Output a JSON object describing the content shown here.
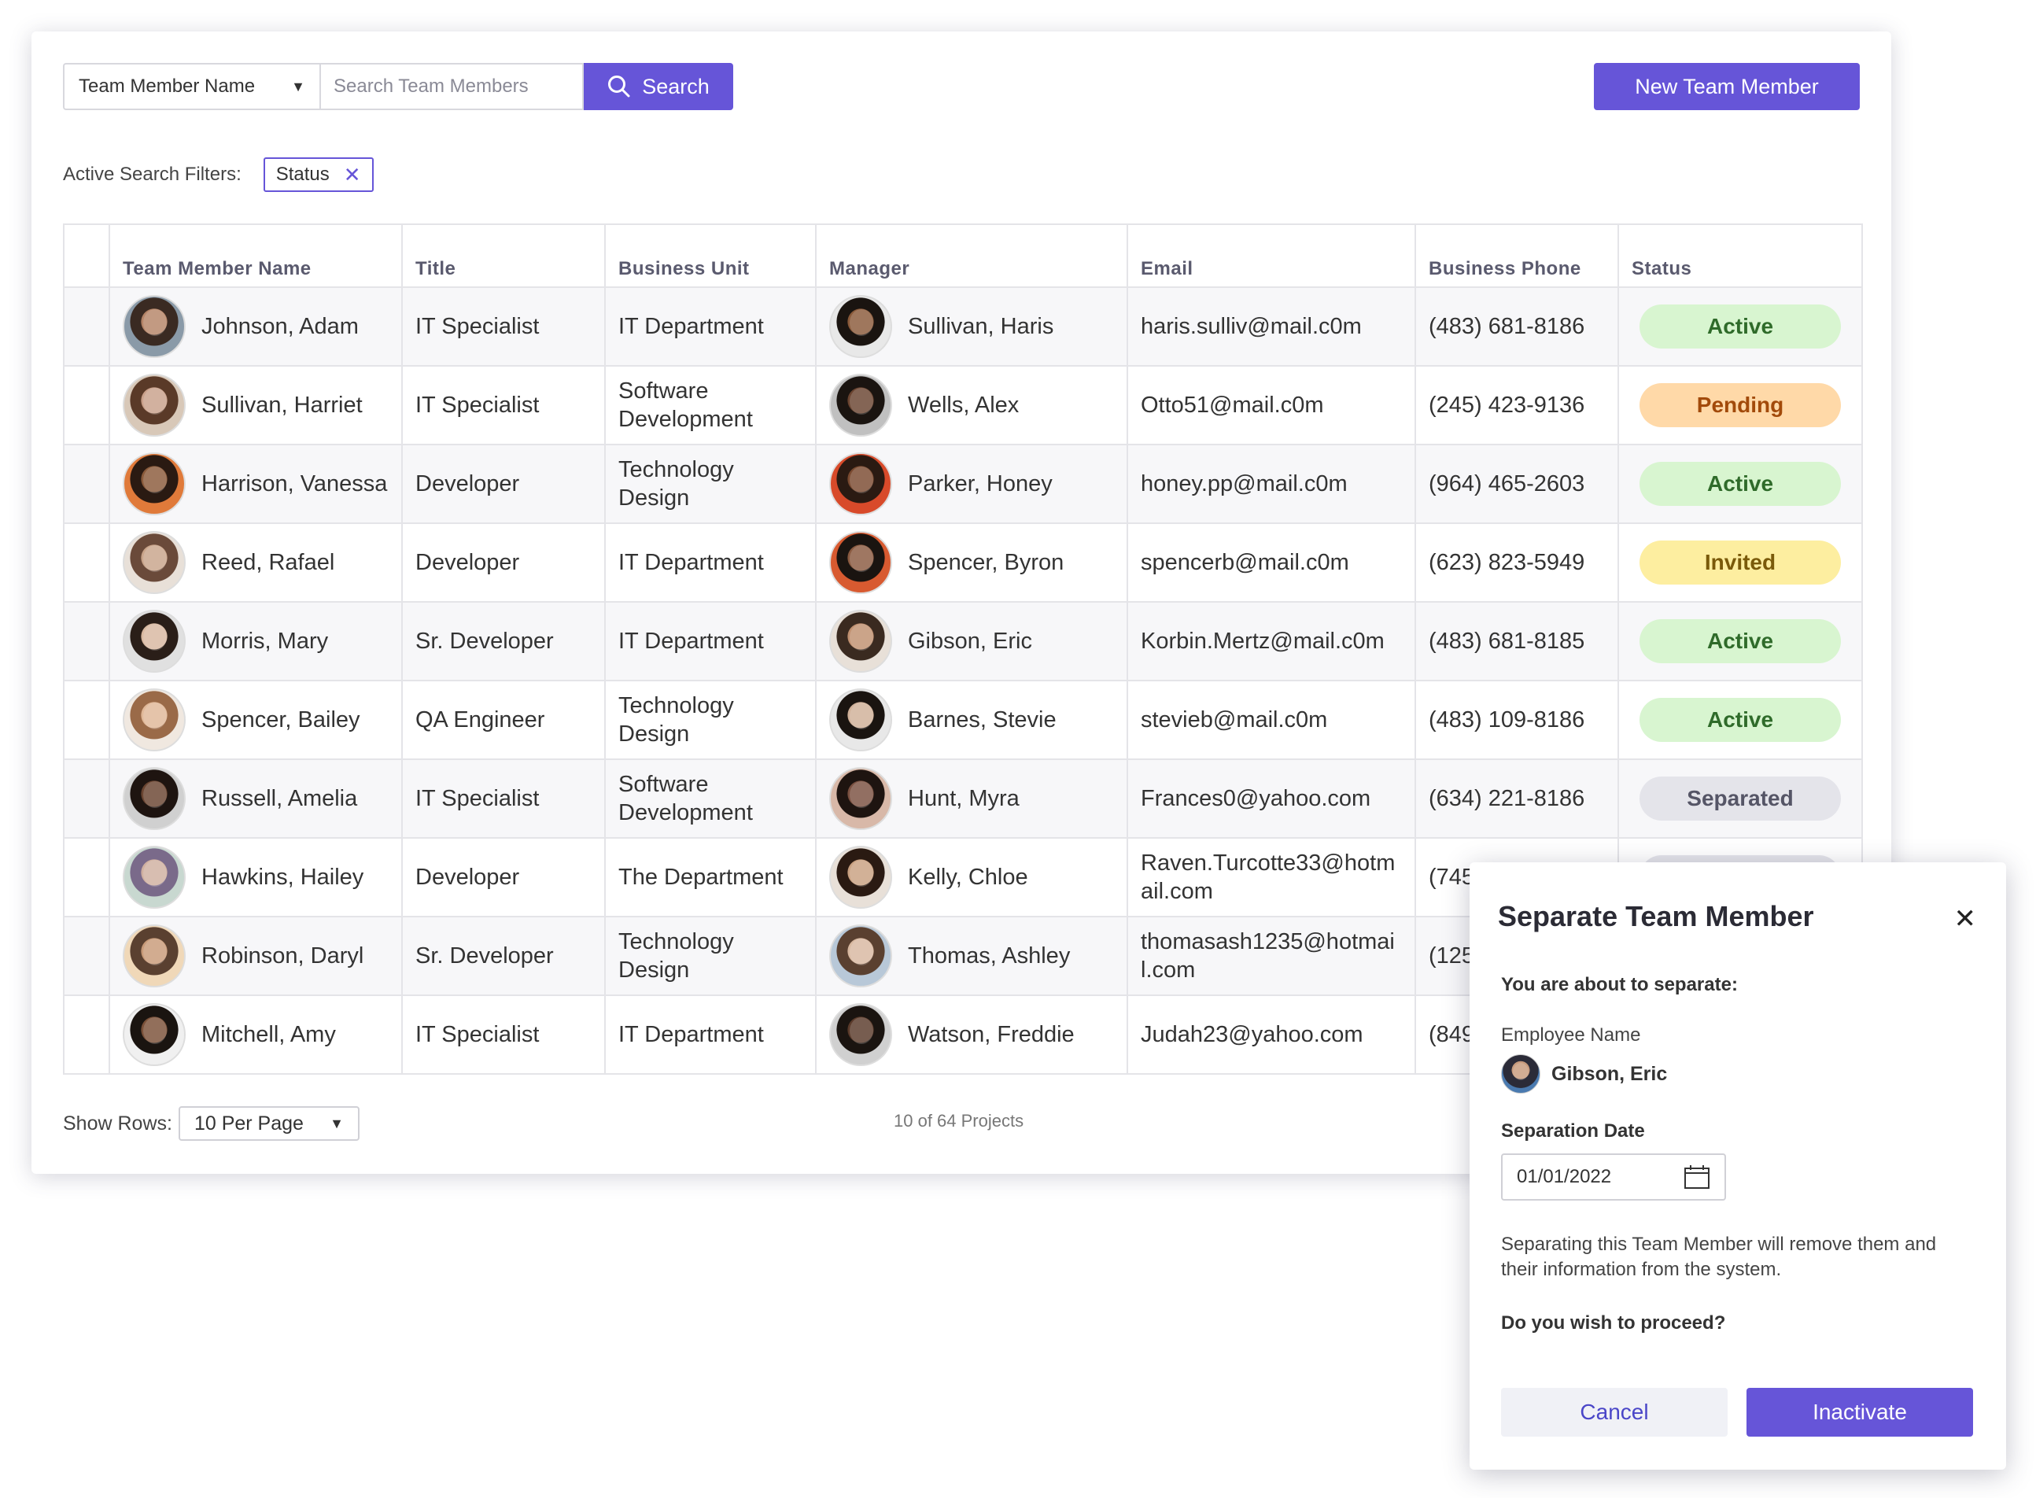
{
  "toolbar": {
    "filter_field": "Team Member Name",
    "search_placeholder": "Search Team Members",
    "search_label": "Search",
    "new_label": "New Team Member"
  },
  "filters": {
    "label": "Active Search Filters:",
    "chips": [
      "Status"
    ]
  },
  "table": {
    "columns": [
      "Team Member Name",
      "Title",
      "Business Unit",
      "Manager",
      "Email",
      "Business Phone",
      "Status"
    ],
    "rows": [
      {
        "name": "Johnson, Adam",
        "title": "IT Specialist",
        "unit": "IT Department",
        "manager": "Sullivan, Haris",
        "email": "haris.sulliv@mail.c0m",
        "phone": "(483) 681-8186",
        "status": "Active",
        "status_kind": "active"
      },
      {
        "name": "Sullivan, Harriet",
        "title": "IT Specialist",
        "unit": "Software Development",
        "manager": "Wells, Alex",
        "email": "Otto51@mail.c0m",
        "phone": "(245) 423-9136",
        "status": "Pending",
        "status_kind": "pending"
      },
      {
        "name": "Harrison, Vanessa",
        "title": "Developer",
        "unit": "Technology Design",
        "manager": "Parker, Honey",
        "email": "honey.pp@mail.c0m",
        "phone": "(964) 465-2603",
        "status": "Active",
        "status_kind": "active"
      },
      {
        "name": "Reed, Rafael",
        "title": "Developer",
        "unit": "IT Department",
        "manager": "Spencer, Byron",
        "email": "spencerb@mail.c0m",
        "phone": "(623) 823-5949",
        "status": "Invited",
        "status_kind": "invited"
      },
      {
        "name": "Morris, Mary",
        "title": "Sr. Developer",
        "unit": "IT Department",
        "manager": "Gibson, Eric",
        "email": "Korbin.Mertz@mail.c0m",
        "phone": "(483) 681-8185",
        "status": "Active",
        "status_kind": "active"
      },
      {
        "name": "Spencer, Bailey",
        "title": "QA Engineer",
        "unit": "Technology Design",
        "manager": "Barnes, Stevie",
        "email": "stevieb@mail.c0m",
        "phone": "(483) 109-8186",
        "status": "Active",
        "status_kind": "active"
      },
      {
        "name": "Russell, Amelia",
        "title": "IT Specialist",
        "unit": "Software Development",
        "manager": "Hunt, Myra",
        "email": "Frances0@yahoo.com",
        "phone": "(634) 221-8186",
        "status": "Separated",
        "status_kind": "separated"
      },
      {
        "name": "Hawkins, Hailey",
        "title": "Developer",
        "unit": "The Department",
        "manager": "Kelly, Chloe",
        "email": "Raven.Turcotte33@hotmail.com",
        "phone": "(745",
        "status": "",
        "status_kind": "separated"
      },
      {
        "name": "Robinson, Daryl",
        "title": "Sr. Developer",
        "unit": "Technology Design",
        "manager": "Thomas, Ashley",
        "email": "thomasash1235@hotmail.com",
        "phone": "(125",
        "status": "",
        "status_kind": "none"
      },
      {
        "name": "Mitchell, Amy",
        "title": "IT Specialist",
        "unit": "IT Department",
        "manager": "Watson, Freddie",
        "email": "Judah23@yahoo.com",
        "phone": "(849",
        "status": "",
        "status_kind": "none"
      }
    ]
  },
  "footer": {
    "rows_label": "Show Rows:",
    "rows_value": "10 Per Page",
    "count": "10 of 64 Projects"
  },
  "modal": {
    "title": "Separate Team Member",
    "subtitle": "You are about to separate:",
    "employee_label": "Employee Name",
    "employee_name": "Gibson, Eric",
    "date_label": "Separation Date",
    "date_value": "01/01/2022",
    "note": "Separating this Team Member will remove them and their information from the system.",
    "question": "Do you wish to proceed?",
    "cancel": "Cancel",
    "confirm": "Inactivate"
  },
  "colors": {
    "accent": "#6655d8",
    "active_bg": "#d8f5d0",
    "pending_bg": "#ffd9a8",
    "invited_bg": "#fdeea0",
    "separated_bg": "#e4e4ea"
  }
}
